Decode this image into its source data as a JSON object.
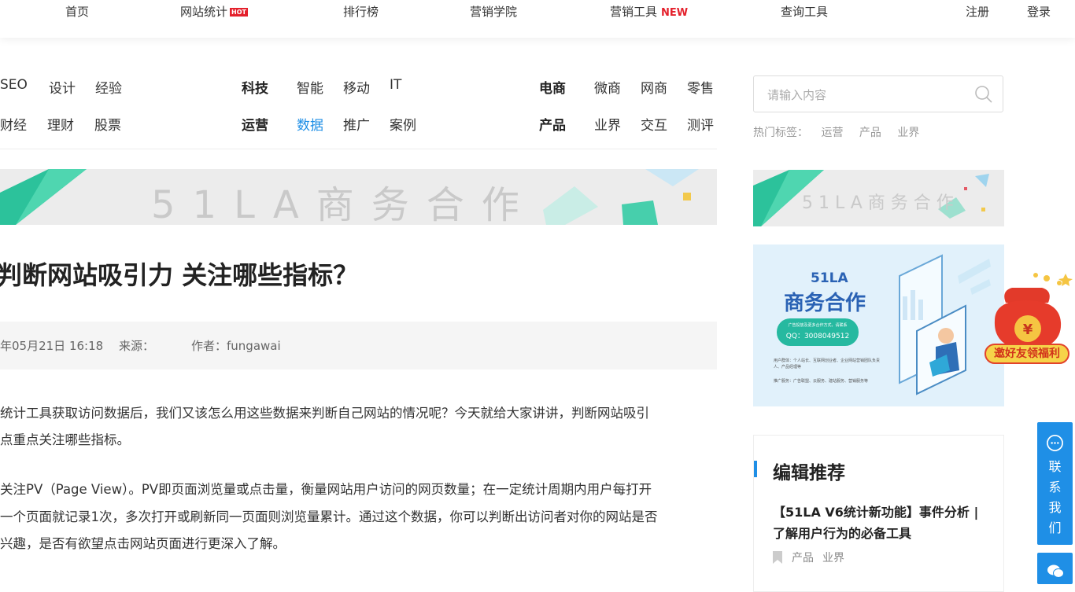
{
  "nav": {
    "home": "首页",
    "site_stats": "网站统计",
    "hot_badge": "HOT",
    "ranking": "排行榜",
    "marketing_academy": "营销学院",
    "marketing_tools": "营销工具",
    "new_badge": "NEW",
    "query_tools": "查询工具",
    "register": "注册",
    "login": "登录"
  },
  "categories": {
    "group1_row1": [
      "SEO",
      "设计",
      "经验"
    ],
    "group1_row2": [
      "财经",
      "理财",
      "股票"
    ],
    "group2_row1_head": "科技",
    "group2_row1": [
      "智能",
      "移动",
      "IT"
    ],
    "group2_row2_head": "运营",
    "group2_row2": [
      "数据",
      "推广",
      "案例"
    ],
    "group3_row1_head": "电商",
    "group3_row1": [
      "微商",
      "网商",
      "零售"
    ],
    "group3_row2_head": "产品",
    "group3_row2": [
      "业界",
      "交互",
      "测评"
    ]
  },
  "banner": {
    "text": "51LA商务合作"
  },
  "article": {
    "title": "判断网站吸引力 关注哪些指标？",
    "date": "年05月21日 16:18",
    "source_label": "来源：",
    "author_label": "作者：fungawai",
    "p1_line1": "统计工具获取访问数据后，我们又该怎么用这些数据来判断自己网站的情况呢？今天就给大家讲讲，判断网站吸引",
    "p1_line2": "点重点关注哪些指标。",
    "p2_line1": "关注PV（Page View）。PV即页面浏览量或点击量，衡量网站用户访问的网页数量；在一定统计周期内用户每打开",
    "p2_line2": "一个页面就记录1次，多次打开或刷新同一页面则浏览量累计。通过这个数据，你可以判断出访问者对你的网站是否",
    "p2_line3": "兴趣，是否有欲望点击网站页面进行更深入了解。"
  },
  "sidebar": {
    "search_placeholder": "请输入内容",
    "hot_tags_label": "热门标签：",
    "hot_tags": [
      "运营",
      "产品",
      "业界"
    ],
    "small_banner_text": "51LA商务合作",
    "ad": {
      "brand": "51LA",
      "headline": "商务合作",
      "contact_line1": "广告投放及更多合作方式，请联系",
      "contact_qq": "QQ：3008049512",
      "users_line": "用户群体：个人站长、互联网创业者、企业网站营销团队负责人、产品经理等",
      "promo_line": "推广服务：广告联盟、云服务、建站服务、营销服务等"
    },
    "recommend": {
      "title": "编辑推荐",
      "article": "【51LA V6统计新功能】事件分析 | 了解用户行为的必备工具",
      "tags": [
        "产品",
        "业界"
      ]
    }
  },
  "float": {
    "contact_chars": [
      "联",
      "系",
      "我",
      "们"
    ],
    "gift_label": "邀好友领福利",
    "gift_coin": "¥"
  },
  "colors": {
    "accent": "#1f8fe6",
    "hot": "#e4212c",
    "teal": "#2cc29b"
  }
}
